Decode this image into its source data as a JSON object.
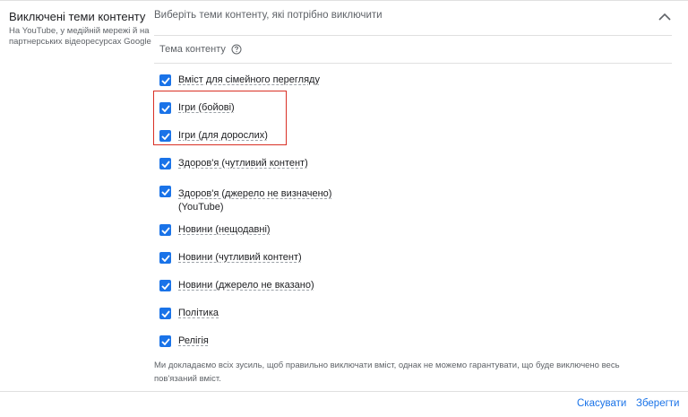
{
  "left_panel": {
    "title": "Виключені теми контенту",
    "subtitle": "На YouTube, у медійній мережі й на партнерських відеоресурсах Google"
  },
  "header": {
    "text": "Виберіть теми контенту, які потрібно виключити",
    "collapse_icon": "chevron-up-icon"
  },
  "section": {
    "label": "Тема контенту",
    "help_icon": "help-circle-icon"
  },
  "options": [
    {
      "label": "Вміст для сімейного перегляду",
      "checked": true
    },
    {
      "label": "Ігри (бойові)",
      "checked": true
    },
    {
      "label": "Ігри (для дорослих)",
      "checked": true
    },
    {
      "label": "Здоров'я (чутливий контент)",
      "checked": true
    },
    {
      "label": "Здоров'я (джерело не визначено)",
      "sublabel": "(YouTube)",
      "checked": true
    },
    {
      "label": "Новини (нещодавні)",
      "checked": true
    },
    {
      "label": "Новини (чутливий контент)",
      "checked": true
    },
    {
      "label": "Новини (джерело не вказано)",
      "checked": true
    },
    {
      "label": "Політика",
      "checked": true
    },
    {
      "label": "Релігія",
      "checked": true
    }
  ],
  "disclaimer": "Ми докладаємо всіх зусиль, щоб правильно виключати вміст, однак не можемо гарантувати, що буде виключено весь пов'язаний вміст.",
  "footer": {
    "cancel_label": "Скасувати",
    "save_label": "Зберегти"
  },
  "colors": {
    "accent": "#1a73e8",
    "highlight": "#d93025"
  }
}
